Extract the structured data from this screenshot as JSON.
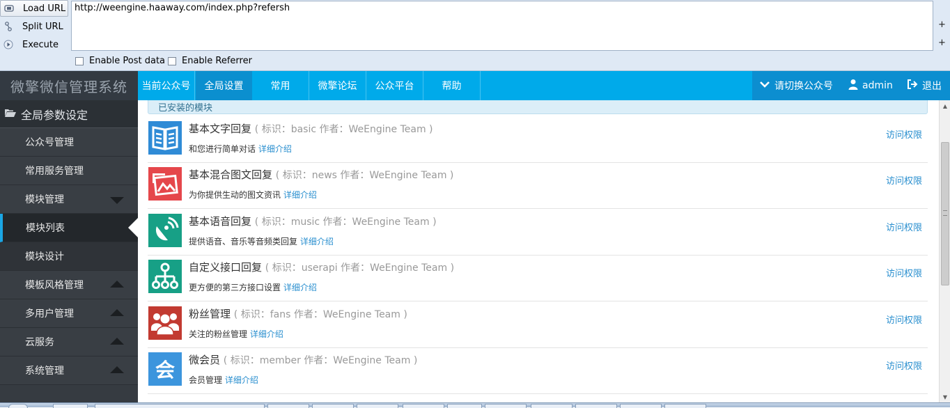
{
  "hackbar": {
    "load_label": "Load URL",
    "split_label": "Split URL",
    "execute_label": "Execute",
    "url_value": "http://weengine.haaway.com/index.php?refersh",
    "side_plus": "+",
    "enable_post_label": "Enable Post data",
    "enable_referrer_label": "Enable Referrer"
  },
  "nav": {
    "brand": "微擎微信管理系统",
    "tabs": [
      "当前公众号",
      "全局设置",
      "常用",
      "微擎论坛",
      "公众平台",
      "帮助"
    ],
    "switch_account": "请切换公众号",
    "user": "admin",
    "logout": "退出"
  },
  "sidebar": {
    "header": "全局参数设定",
    "items": [
      {
        "label": "公众号管理"
      },
      {
        "label": "常用服务管理"
      },
      {
        "label": "模块管理"
      },
      {
        "label": "模块列表"
      },
      {
        "label": "模块设计"
      },
      {
        "label": "模板风格管理"
      },
      {
        "label": "多用户管理"
      },
      {
        "label": "云服务"
      },
      {
        "label": "系统管理"
      }
    ]
  },
  "main": {
    "panel_title": "已安装的模块",
    "modules": [
      {
        "name": "基本文字回复",
        "meta": "( 标识：basic   作者：WeEngine Team )",
        "desc": "和您进行简单对话",
        "detail": "详细介绍",
        "perm": "访问权限",
        "color": "#2f8bd6"
      },
      {
        "name": "基本混合图文回复",
        "meta": "( 标识：news   作者：WeEngine Team )",
        "desc": "为你提供生动的图文资讯",
        "detail": "详细介绍",
        "perm": "访问权限",
        "color": "#e5474b"
      },
      {
        "name": "基本语音回复",
        "meta": "( 标识：music   作者：WeEngine Team )",
        "desc": "提供语音、音乐等音频类回复",
        "detail": "详细介绍",
        "perm": "访问权限",
        "color": "#17a086"
      },
      {
        "name": "自定义接口回复",
        "meta": "( 标识：userapi   作者：WeEngine Team )",
        "desc": "更方便的第三方接口设置",
        "detail": "详细介绍",
        "perm": "访问权限",
        "color": "#17a086"
      },
      {
        "name": "粉丝管理",
        "meta": "( 标识：fans   作者：WeEngine Team )",
        "desc": "关注的粉丝管理",
        "detail": "详细介绍",
        "perm": "访问权限",
        "color": "#c23a31"
      },
      {
        "name": "微会员",
        "meta": "( 标识：member   作者：WeEngine Team )",
        "desc": "会员管理",
        "detail": "详细介绍",
        "perm": "访问权限",
        "color": "#3c95dd"
      }
    ],
    "member_icon_char": "会"
  }
}
